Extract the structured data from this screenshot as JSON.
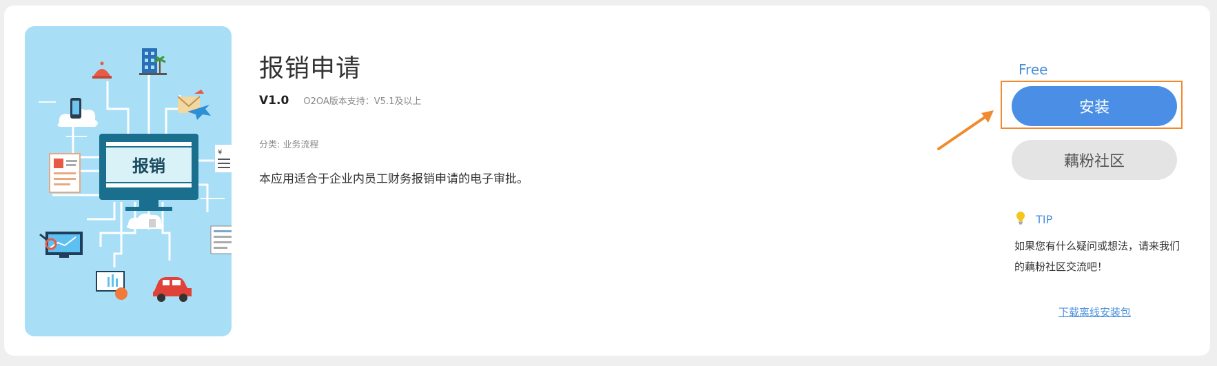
{
  "app": {
    "title": "报销申请",
    "version": "V1.0",
    "compat": "O2OA版本支持：V5.1及以上",
    "category": "分类: 业务流程",
    "description": "本应用适合于企业内员工财务报销申请的电子审批。",
    "image_label": "报销"
  },
  "sidebar": {
    "price": "Free",
    "install_label": "安装",
    "community_label": "藕粉社区",
    "tip_label": "TIP",
    "tip_text": "如果您有什么疑问或想法，请来我们的藕粉社区交流吧！",
    "download_link": "下载离线安装包"
  },
  "colors": {
    "accent": "#4a8fe5",
    "highlight": "#f08a2c",
    "image_bg": "#a8def6"
  },
  "icons": {
    "tip": "lightbulb-icon",
    "annotation": "arrow-icon"
  }
}
